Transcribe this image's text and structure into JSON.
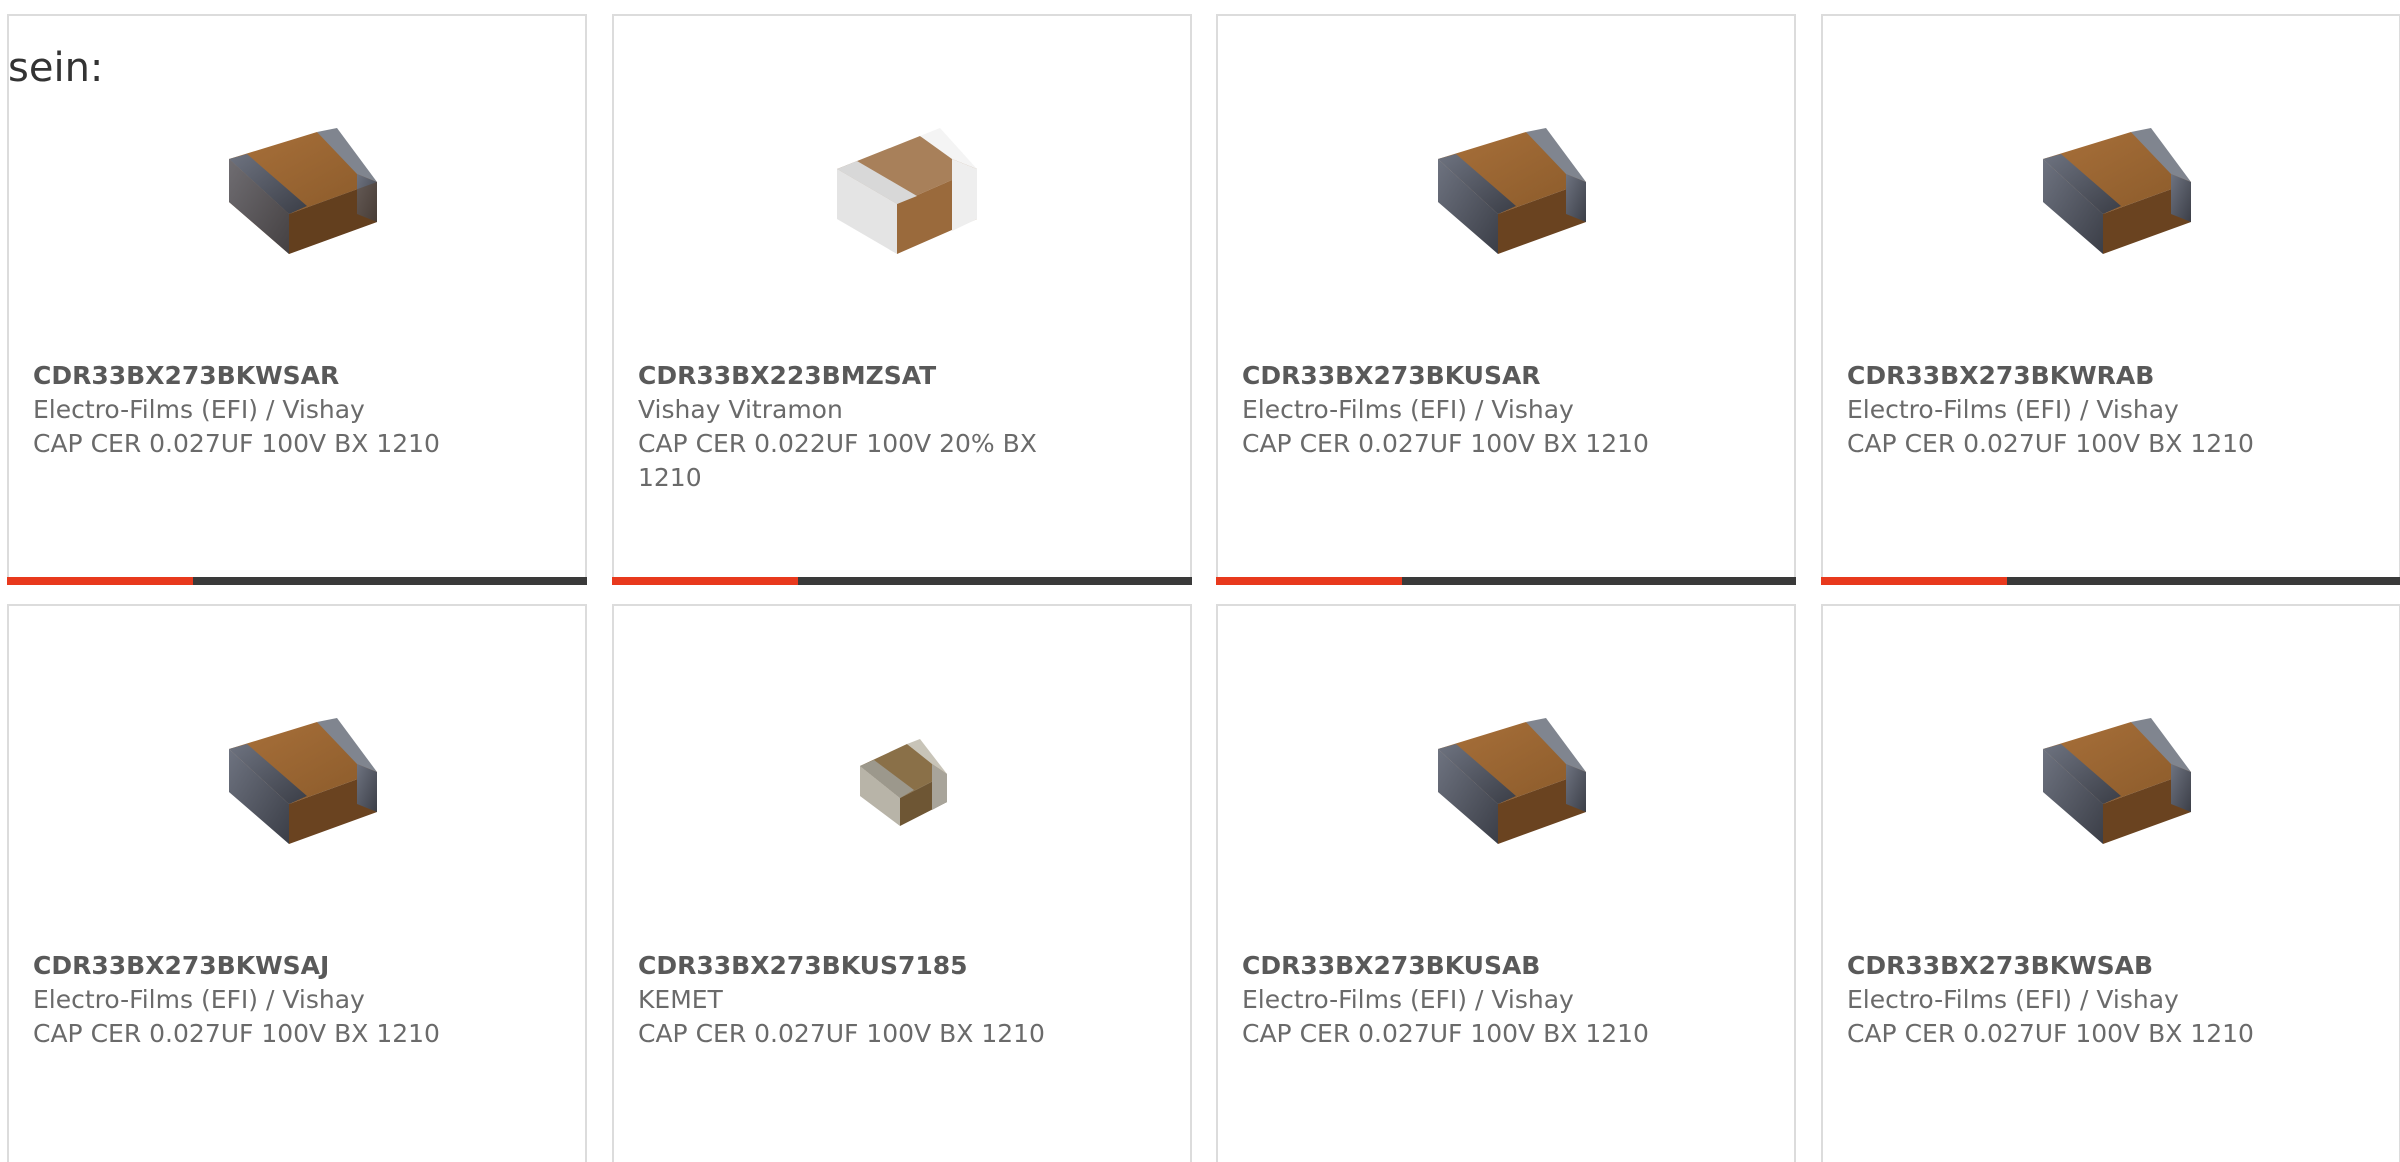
{
  "heading": "sein:",
  "colors": {
    "accent": "#e8391d",
    "track": "#3a3a3a",
    "card_border": "#dcdcdc",
    "text_bold": "#595959",
    "text": "#6a6a6a"
  },
  "products": [
    {
      "part_number": "CDR33BX273BKWSAR",
      "manufacturer": "Electro-Films (EFI) / Vishay",
      "description": "CAP CER 0.027UF 100V BX 1210",
      "image_icon": "ceramic-capacitor-brown-icon",
      "progress": 0.32
    },
    {
      "part_number": "CDR33BX223BMZSAT",
      "manufacturer": "Vishay Vitramon",
      "description": "CAP CER 0.022UF 100V 20% BX 1210",
      "image_icon": "ceramic-capacitor-white-icon",
      "progress": 0.32
    },
    {
      "part_number": "CDR33BX273BKUSAR",
      "manufacturer": "Electro-Films (EFI) / Vishay",
      "description": "CAP CER 0.027UF 100V BX 1210",
      "image_icon": "ceramic-capacitor-brown-icon",
      "progress": 0.32
    },
    {
      "part_number": "CDR33BX273BKWRAB",
      "manufacturer": "Electro-Films (EFI) / Vishay",
      "description": "CAP CER 0.027UF 100V BX 1210",
      "image_icon": "ceramic-capacitor-brown-icon",
      "progress": 0.32
    },
    {
      "part_number": "CDR33BX273BKWSAJ",
      "manufacturer": "Electro-Films (EFI) / Vishay",
      "description": "CAP CER 0.027UF 100V BX 1210",
      "image_icon": "ceramic-capacitor-brown-icon"
    },
    {
      "part_number": "CDR33BX273BKUS7185",
      "manufacturer": "KEMET",
      "description": "CAP CER 0.027UF 100V BX 1210",
      "image_icon": "ceramic-capacitor-small-icon"
    },
    {
      "part_number": "CDR33BX273BKUSAB",
      "manufacturer": "Electro-Films (EFI) / Vishay",
      "description": "CAP CER 0.027UF 100V BX 1210",
      "image_icon": "ceramic-capacitor-brown-icon"
    },
    {
      "part_number": "CDR33BX273BKWSAB",
      "manufacturer": "Electro-Films (EFI) / Vishay",
      "description": "CAP CER 0.027UF 100V BX 1210",
      "image_icon": "ceramic-capacitor-brown-icon"
    }
  ]
}
